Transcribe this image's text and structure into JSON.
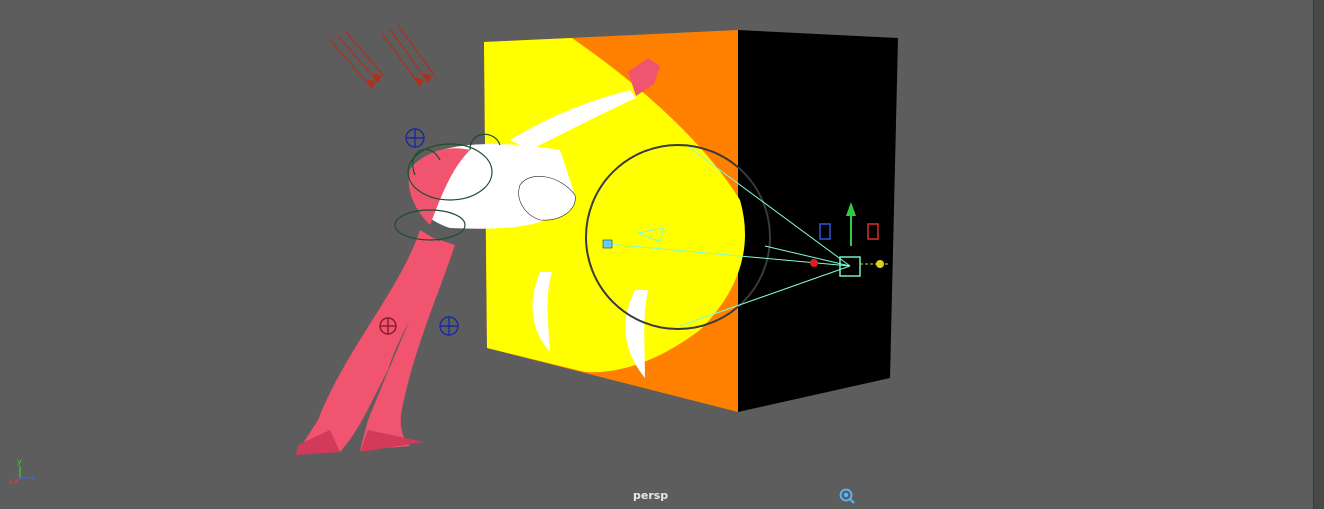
{
  "viewport": {
    "camera_name": "persp",
    "background": "#5d5d5d"
  },
  "axis_gizmo": {
    "x_label": "x",
    "y_label": "y",
    "z_label": "z",
    "x_color": "#e03a3a",
    "y_color": "#3acb3a",
    "z_color": "#3a6be0"
  },
  "scene": {
    "cube_lit_color": "#ffff00",
    "cube_front_color": "#ff8000",
    "cube_side_color": "#000000",
    "character_color": "#f0546e",
    "light_manipulator_color": "#7fffd4",
    "directional_light_color": "#b0301a"
  },
  "icons": {
    "camera_icon": "camera-search-icon",
    "scrollbar": "vertical-scrollbar"
  }
}
